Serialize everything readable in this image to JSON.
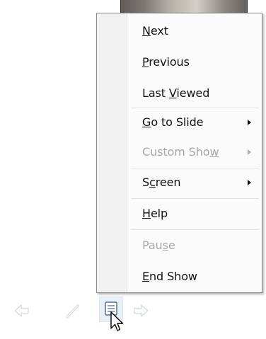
{
  "context_menu": {
    "items": [
      {
        "label": "Next",
        "accel": "N",
        "disabled": false,
        "submenu": false
      },
      {
        "label": "Previous",
        "accel": "P",
        "disabled": false,
        "submenu": false
      },
      {
        "label": "Last Viewed",
        "accel": "V",
        "disabled": false,
        "submenu": false
      },
      {
        "label": "Go to Slide",
        "accel": "G",
        "disabled": false,
        "submenu": true
      },
      {
        "label": "Custom Show",
        "accel": "w",
        "disabled": true,
        "submenu": true
      },
      {
        "label": "Screen",
        "accel": "c",
        "disabled": false,
        "submenu": true
      },
      {
        "label": "Help",
        "accel": "H",
        "disabled": false,
        "submenu": false
      },
      {
        "label": "Pause",
        "accel": "s",
        "disabled": true,
        "submenu": false
      },
      {
        "label": "End Show",
        "accel": "E",
        "disabled": false,
        "submenu": false
      }
    ]
  },
  "toolbar": {
    "buttons": [
      {
        "icon": "previous-arrow-icon"
      },
      {
        "icon": "pen-icon"
      },
      {
        "icon": "slide-menu-icon"
      },
      {
        "icon": "next-arrow-icon"
      }
    ]
  },
  "colors": {
    "menu_background": "#fbfbfb",
    "menu_gutter": "#f2f2f2",
    "menu_border": "#8d8d8d",
    "text": "#111111",
    "disabled_text": "#a8a8a8",
    "toolbar_icon": "#d9dde2",
    "active_button_bg": "#e9eff7"
  }
}
